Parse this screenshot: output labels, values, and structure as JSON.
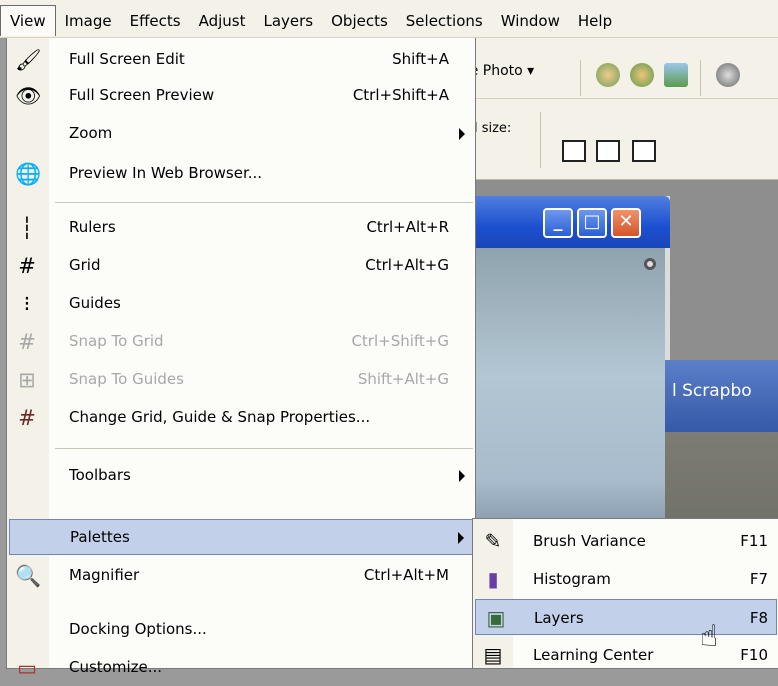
{
  "menubar": [
    {
      "label": "View",
      "open": true
    },
    {
      "label": "Image"
    },
    {
      "label": "Effects"
    },
    {
      "label": "Adjust"
    },
    {
      "label": "Layers"
    },
    {
      "label": "Objects"
    },
    {
      "label": "Selections"
    },
    {
      "label": "Window"
    },
    {
      "label": "Help"
    }
  ],
  "background": {
    "enhance_label": "ce Photo ▾",
    "size_label": "al size:",
    "window_fragment": ")",
    "window2_title": "l Scrapbo"
  },
  "view_menu": {
    "items": [
      {
        "label": "Full Screen Edit",
        "shortcut": "Shift+A",
        "icon": "full-screen-edit-icon",
        "glyph": "🖌"
      },
      {
        "label": "Full Screen Preview",
        "shortcut": "Ctrl+Shift+A",
        "icon": "full-screen-preview-icon",
        "glyph": "👁"
      },
      {
        "label": "Zoom",
        "submenu": true
      },
      {
        "label": "Preview In Web Browser...",
        "icon": "web-browser-icon",
        "glyph": "🌐"
      },
      {
        "label": "Rulers",
        "shortcut": "Ctrl+Alt+R",
        "icon": "rulers-icon",
        "glyph": "┆"
      },
      {
        "label": "Grid",
        "shortcut": "Ctrl+Alt+G",
        "icon": "grid-icon",
        "glyph": "#"
      },
      {
        "label": "Guides",
        "icon": "guides-icon",
        "glyph": "⁝"
      },
      {
        "label": "Snap To Grid",
        "shortcut": "Ctrl+Shift+G",
        "disabled": true,
        "icon": "snap-grid-icon",
        "glyph": "#"
      },
      {
        "label": "Snap To Guides",
        "shortcut": "Shift+Alt+G",
        "disabled": true,
        "icon": "snap-guides-icon",
        "glyph": "⊞"
      },
      {
        "label": "Change Grid, Guide & Snap Properties...",
        "icon": "grid-properties-icon",
        "glyph": "#"
      },
      {
        "label": "Toolbars",
        "submenu": true
      },
      {
        "label": "Palettes",
        "submenu": true,
        "highlighted": true
      },
      {
        "label": "Magnifier",
        "shortcut": "Ctrl+Alt+M",
        "icon": "magnifier-icon",
        "glyph": "🔍"
      },
      {
        "label": "Docking Options..."
      },
      {
        "label": "Customize...",
        "icon": "customize-icon",
        "glyph": "▭"
      }
    ]
  },
  "palettes_submenu": {
    "items": [
      {
        "label": "Brush Variance",
        "shortcut": "F11",
        "icon": "brush-variance-icon",
        "glyph": "✎"
      },
      {
        "label": "Histogram",
        "shortcut": "F7",
        "icon": "histogram-icon",
        "glyph": "▮"
      },
      {
        "label": "Layers",
        "shortcut": "F8",
        "highlighted": true,
        "icon": "layers-icon",
        "glyph": "▣"
      },
      {
        "label": "Learning Center",
        "shortcut": "F10",
        "icon": "learning-center-icon",
        "glyph": "▤"
      }
    ]
  },
  "colors": {
    "highlight": "#c3d0e9",
    "highlight_border": "#6f87bb",
    "disabled": "#a8a8a8"
  }
}
